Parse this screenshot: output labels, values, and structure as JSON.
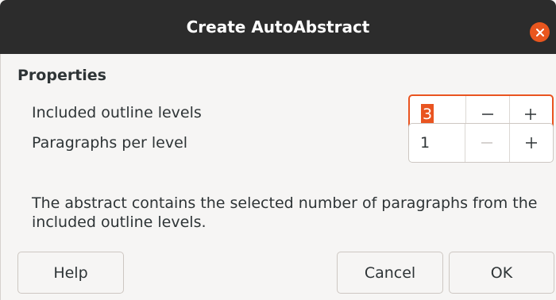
{
  "dialog": {
    "title": "Create AutoAbstract",
    "close_icon": "close-icon"
  },
  "properties": {
    "heading": "Properties",
    "outline_levels": {
      "label": "Included outline levels",
      "value": "3",
      "decrement": "minus-icon",
      "increment": "plus-icon"
    },
    "paragraphs": {
      "label": "Paragraphs per level",
      "value": "1",
      "decrement": "minus-icon",
      "increment": "plus-icon"
    },
    "description": "The abstract contains the selected number of paragraphs from the included outline levels."
  },
  "buttons": {
    "help": "Help",
    "cancel": "Cancel",
    "ok": "OK"
  },
  "colors": {
    "accent": "#e95420",
    "titlebar": "#2c2c2c",
    "close": "#e9561e"
  }
}
